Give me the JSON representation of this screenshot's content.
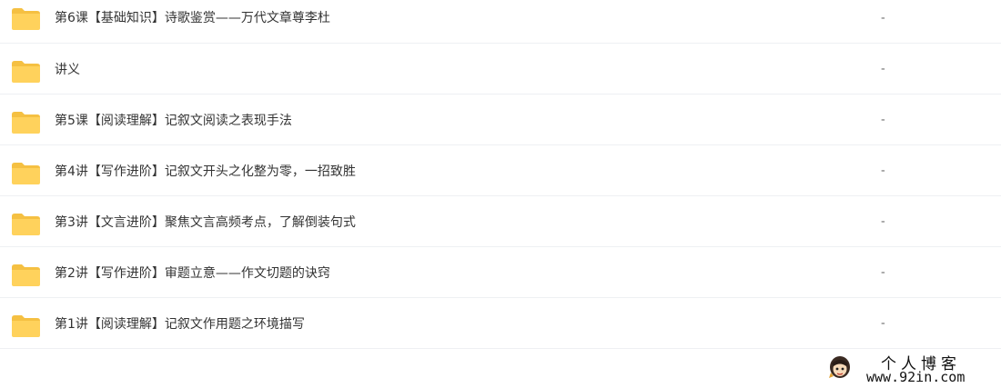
{
  "folders": [
    {
      "name": "第6课【基础知识】诗歌鉴赏——万代文章尊李杜",
      "size": "-",
      "icon": "folder-icon"
    },
    {
      "name": "讲义",
      "size": "-",
      "icon": "folder-icon"
    },
    {
      "name": "第5课【阅读理解】记叙文阅读之表现手法",
      "size": "-",
      "icon": "folder-icon"
    },
    {
      "name": "第4讲【写作进阶】记叙文开头之化整为零，一招致胜",
      "size": "-",
      "icon": "folder-icon"
    },
    {
      "name": "第3讲【文言进阶】聚焦文言高频考点，了解倒装句式",
      "size": "-",
      "icon": "folder-icon"
    },
    {
      "name": "第2讲【写作进阶】审题立意——作文切题的诀窍",
      "size": "-",
      "icon": "folder-icon"
    },
    {
      "name": "第1讲【阅读理解】记叙文作用题之环境描写",
      "size": "-",
      "icon": "folder-icon"
    }
  ],
  "watermark": {
    "title": "个人博客",
    "url": "www.92in.com",
    "icon": "avatar-icon"
  },
  "colors": {
    "folder": "#FFD25C",
    "folder_tab": "#F5C042",
    "text": "#333333",
    "row_border": "#EEF0F3"
  }
}
